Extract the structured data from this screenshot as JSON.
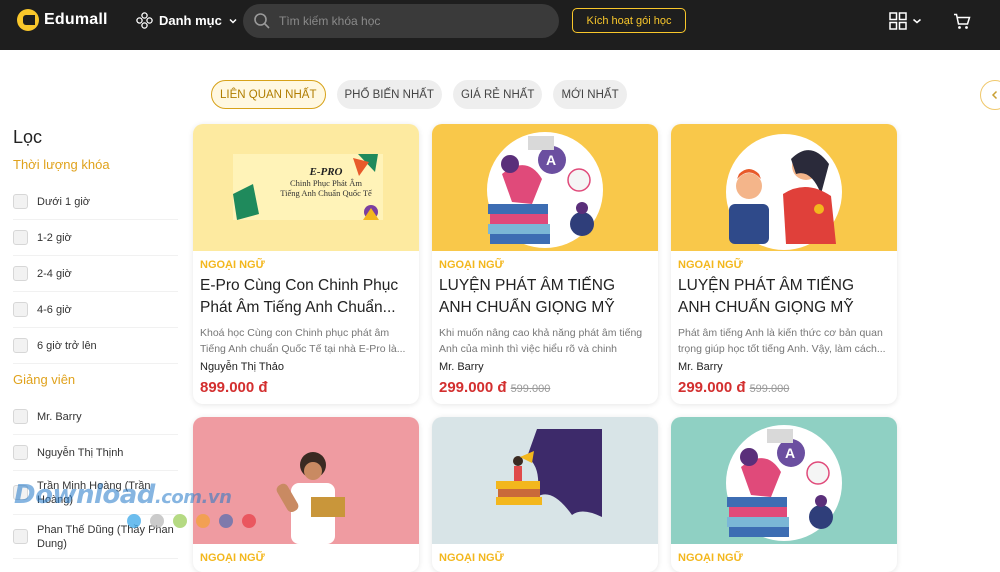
{
  "header": {
    "logo_text": "Edumall",
    "categories_label": "Danh mục",
    "search_placeholder": "Tìm kiếm khóa học",
    "activate_label": "Kích hoạt gói học"
  },
  "tabs": [
    {
      "label": "LIÊN QUAN NHẤT",
      "active": true
    },
    {
      "label": "PHỔ BIẾN NHẤT",
      "active": false
    },
    {
      "label": "GIÁ RẺ NHẤT",
      "active": false
    },
    {
      "label": "MỚI NHẤT",
      "active": false
    }
  ],
  "filters": {
    "title": "Lọc",
    "duration": {
      "label": "Thời lượng khóa",
      "options": [
        "Dưới 1 giờ",
        "1-2 giờ",
        "2-4 giờ",
        "4-6 giờ",
        "6 giờ trở lên"
      ]
    },
    "instructor": {
      "label": "Giảng viên",
      "options": [
        "Mr. Barry",
        "Nguyễn Thị Thịnh",
        "Trần Minh Hoàng (Trần Hoàng)",
        "Phan Thế Dũng (Thầy Phan Dung)"
      ]
    }
  },
  "courses": [
    {
      "category": "NGOẠI NGỮ",
      "title": "E-Pro Cùng Con Chinh Phục Phát Âm Tiếng Anh Chuẩn...",
      "description": "Khoá học Cùng con Chinh phục phát âm Tiếng Anh chuẩn Quốc Tế tại nhà E-Pro là...",
      "author": "Nguyễn Thị Thảo",
      "price": "899.000 đ",
      "old_price": "",
      "thumb_bg": "#fdeaa0",
      "thumb_text": {
        "brand": "E-PRO",
        "line1": "Chinh Phục Phát Âm",
        "line2": "Tiếng Anh Chuẩn Quốc Tế"
      }
    },
    {
      "category": "NGOẠI NGỮ",
      "title": "LUYỆN PHÁT ÂM TIẾNG ANH CHUẨN GIỌNG MỸ CÙNG...",
      "description": "Khi muốn nâng cao khả năng phát âm tiếng Anh của mình thì việc hiểu rõ và chinh phục...",
      "author": "Mr. Barry",
      "price": "299.000 đ",
      "old_price": "599.000",
      "thumb_bg": "#f9c84a"
    },
    {
      "category": "NGOẠI NGỮ",
      "title": "LUYỆN PHÁT ÂM TIẾNG ANH CHUẨN GIỌNG MỸ CÙNG...",
      "description": "Phát âm tiếng Anh là kiến thức cơ bản quan trọng giúp học tốt tiếng Anh. Vậy, làm cách...",
      "author": "Mr. Barry",
      "price": "299.000 đ",
      "old_price": "599.000",
      "thumb_bg": "#f9c84a"
    },
    {
      "category": "NGOẠI NGỮ",
      "thumb_bg": "#ef9ba1"
    },
    {
      "category": "NGOẠI NGỮ",
      "thumb_bg": "#d8e4e7"
    },
    {
      "category": "NGOẠI NGỮ",
      "thumb_bg": "#8fd0c3"
    }
  ],
  "watermark": {
    "text": "Download",
    "suffix": ".com.vn"
  },
  "colors": {
    "accent": "#f9c72b",
    "price": "#d32f2f",
    "header_bg": "#1e1e1e"
  }
}
